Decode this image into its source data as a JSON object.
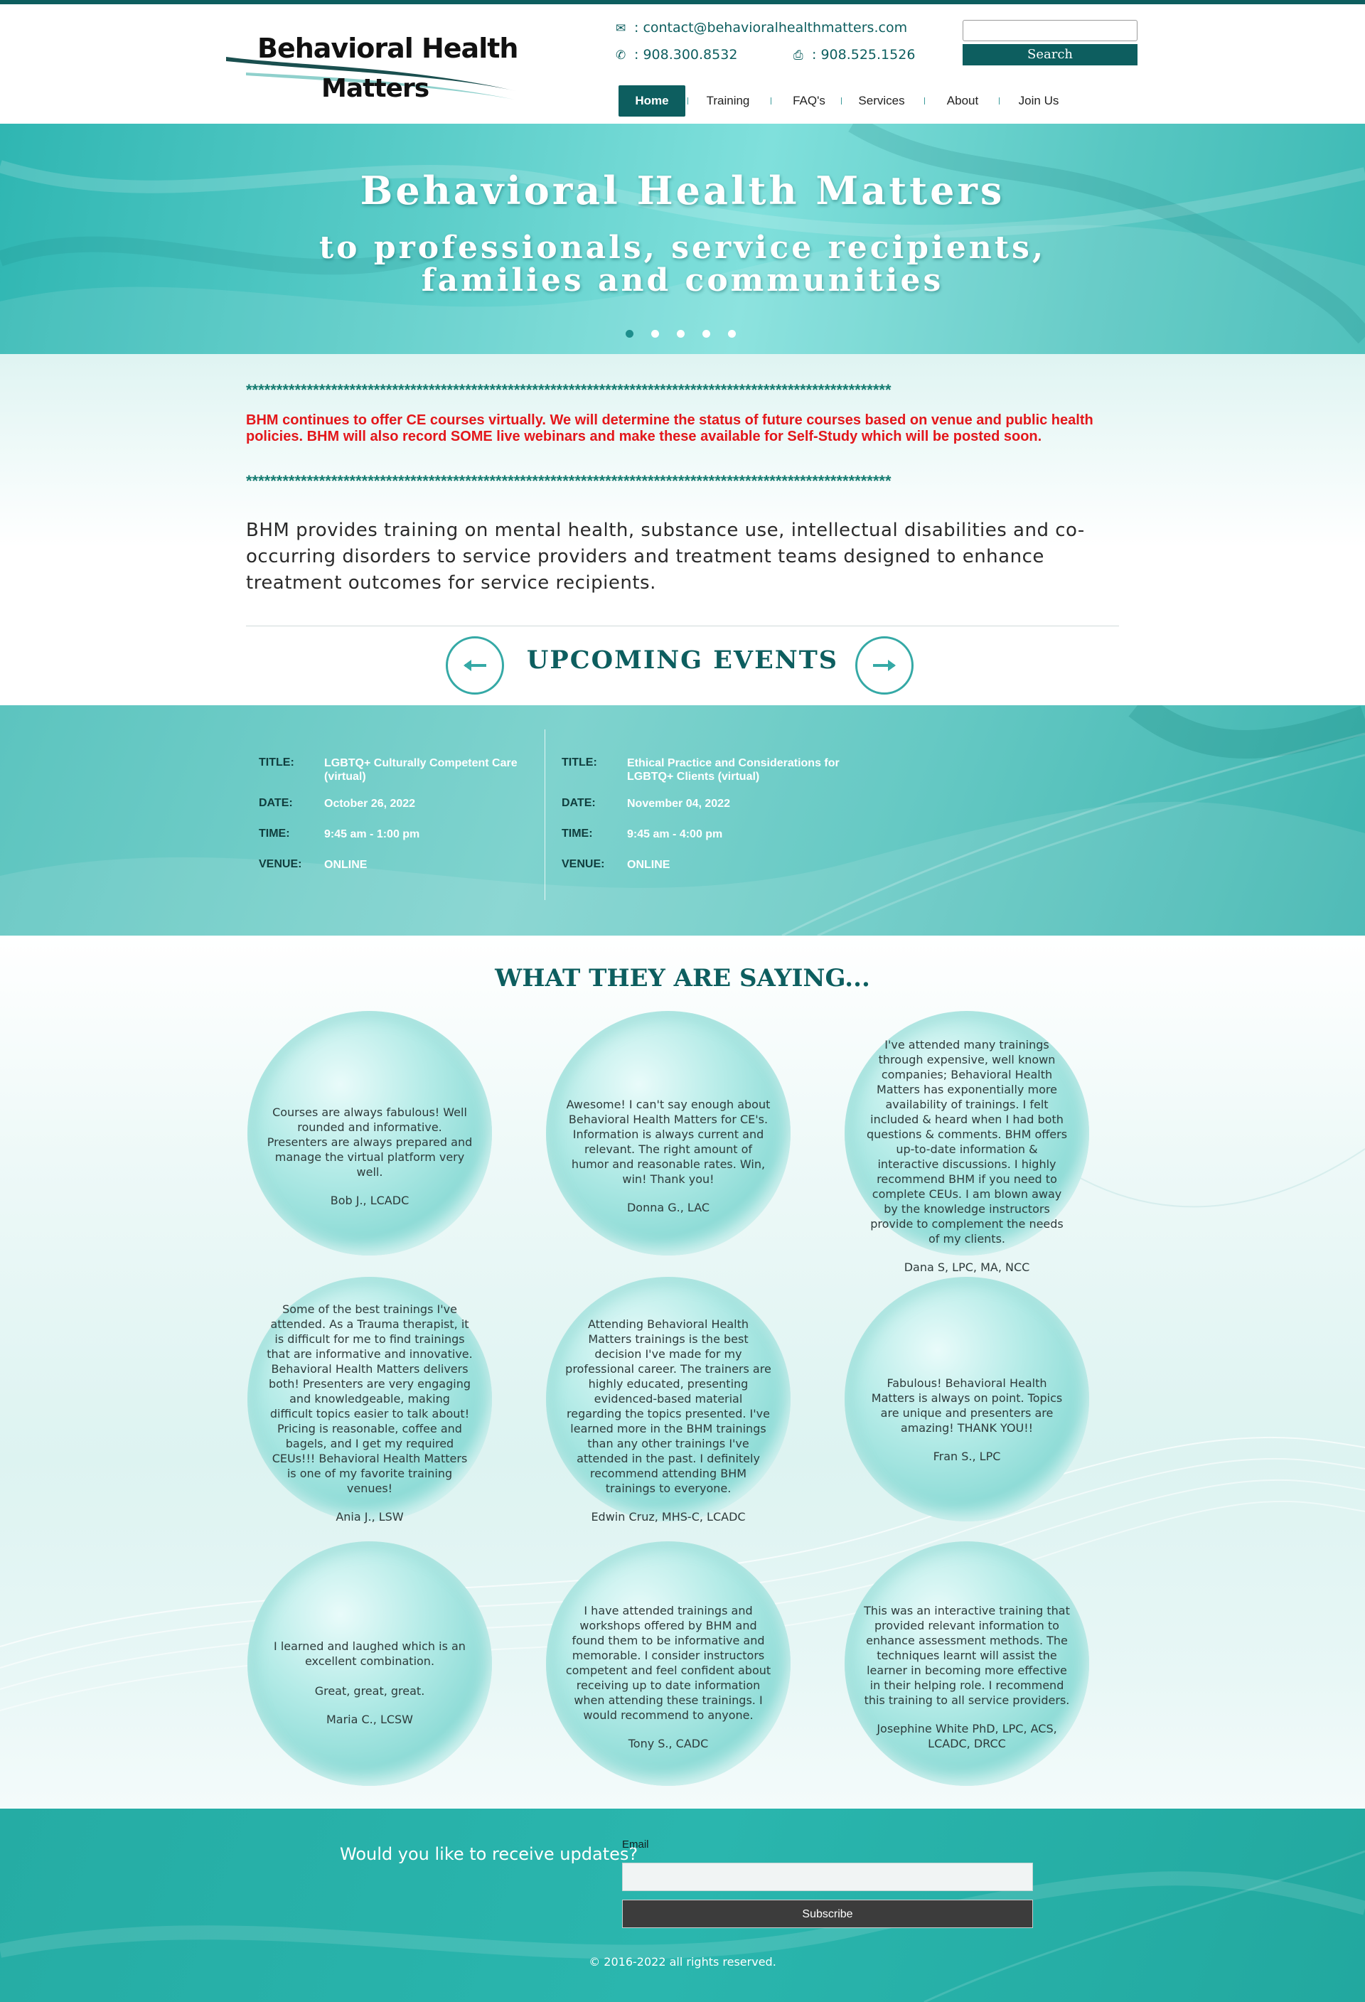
{
  "brand": {
    "logo_line1": "Behavioral Health",
    "logo_line2": "Matters"
  },
  "header": {
    "email": ": contact@behavioralhealthmatters.com",
    "phone": ": 908.300.8532",
    "fax": ": 908.525.1526",
    "search_placeholder": "",
    "search_button": "Search",
    "icons": {
      "email": "envelope-icon",
      "phone": "phone-icon",
      "fax": "fax-icon"
    }
  },
  "nav": {
    "items": [
      {
        "label": "Home",
        "active": true
      },
      {
        "label": "Training"
      },
      {
        "label": "FAQ's"
      },
      {
        "label": "Services"
      },
      {
        "label": "About"
      },
      {
        "label": "Join Us"
      }
    ]
  },
  "hero": {
    "title": "Behavioral Health Matters",
    "subtitle_line1": "to professionals, service recipients,",
    "subtitle_line2": "families and communities",
    "slide_count": 5,
    "active_slide": 1
  },
  "notice": {
    "stars": "**********************************************************************************************************",
    "text": "BHM continues to offer CE courses virtually. We will determine the status of future courses based on venue and public health policies. BHM will also record SOME live webinars and make these available for Self-Study which will be posted soon."
  },
  "intro": {
    "text": "BHM provides training on mental health, substance use, intellectual disabilities and co-occurring disorders to service providers and treatment teams designed to enhance treatment outcomes for service recipients."
  },
  "events": {
    "heading": "UPCOMING EVENTS",
    "labels": {
      "title": "TITLE:",
      "date": "DATE:",
      "time": "TIME:",
      "venue": "VENUE:"
    },
    "items": [
      {
        "title": "LGBTQ+ Culturally Competent Care (virtual)",
        "date": "October 26, 2022",
        "time": "9:45 am - 1:00 pm",
        "venue": "ONLINE"
      },
      {
        "title": "Ethical Practice and Considerations for LGBTQ+ Clients (virtual)",
        "date": "November 04, 2022",
        "time": "9:45 am - 4:00 pm",
        "venue": "ONLINE"
      }
    ]
  },
  "testimonials": {
    "heading": "WHAT THEY ARE SAYING...",
    "items": [
      {
        "quote": "Courses are always fabulous!  Well rounded and informative. Presenters are always prepared and manage the virtual platform very well.",
        "author": "Bob J., LCADC"
      },
      {
        "quote": "Awesome!  I can't say enough about Behavioral Health Matters for CE's.  Information is always current and relevant.  The right amount of humor and reasonable rates.  Win, win!  Thank you!",
        "author": "Donna G., LAC"
      },
      {
        "quote": "I've attended many trainings through expensive, well known companies; Behavioral Health Matters has exponentially more availability of trainings. I felt included & heard when I had both questions & comments. BHM offers up-to-date information & interactive discussions. I highly recommend BHM if you need to complete CEUs. I am blown away by the knowledge instructors provide to complement the needs of my clients.",
        "author": "Dana S, LPC, MA, NCC"
      },
      {
        "quote": "Some of the best trainings I've attended. As a Trauma therapist, it is difficult for me to find trainings that are informative and innovative. Behavioral Health Matters delivers both!  Presenters are very engaging and knowledgeable, making difficult topics easier to talk about! Pricing is reasonable, coffee and bagels, and I get my required CEUs!!! Behavioral Health Matters is one of my favorite training venues!",
        "author": "Ania J., LSW"
      },
      {
        "quote": "Attending Behavioral Health Matters trainings is the best decision I've made for my professional career.  The trainers are highly educated, presenting evidenced-based material regarding the topics presented.  I've learned more in the BHM trainings than any other trainings I've attended in the past.  I definitely recommend attending BHM trainings to everyone.",
        "author": "Edwin Cruz, MHS-C, LCADC"
      },
      {
        "quote": "Fabulous!  Behavioral Health Matters is always on point.  Topics are unique and presenters are amazing!  THANK YOU!!",
        "author": "Fran S., LPC"
      },
      {
        "quote": "I learned and laughed which is an excellent combination.\n\nGreat, great, great.",
        "author": "Maria C., LCSW"
      },
      {
        "quote": "I have attended trainings and workshops offered by BHM and found them to be informative and memorable. I consider instructors competent and feel confident about receiving up to date information when attending these trainings. I would recommend to anyone.",
        "author": "Tony S., CADC"
      },
      {
        "quote": "This was an interactive training that provided relevant information to enhance assessment methods. The techniques learnt will assist the learner in becoming more effective in their helping role. I recommend this training to all service providers.",
        "author": "Josephine White PhD, LPC, ACS, LCADC, DRCC"
      }
    ]
  },
  "footer": {
    "question": "Would you like to receive updates?",
    "email_label": "Email",
    "email_value": "",
    "subscribe": "Subscribe",
    "copyright": "© 2016-2022 all rights reserved."
  },
  "colors": {
    "brand_dark": "#0d5e5f",
    "teal": "#35a9a6",
    "notice_red": "#e3171b",
    "footer": "#25aca4"
  }
}
